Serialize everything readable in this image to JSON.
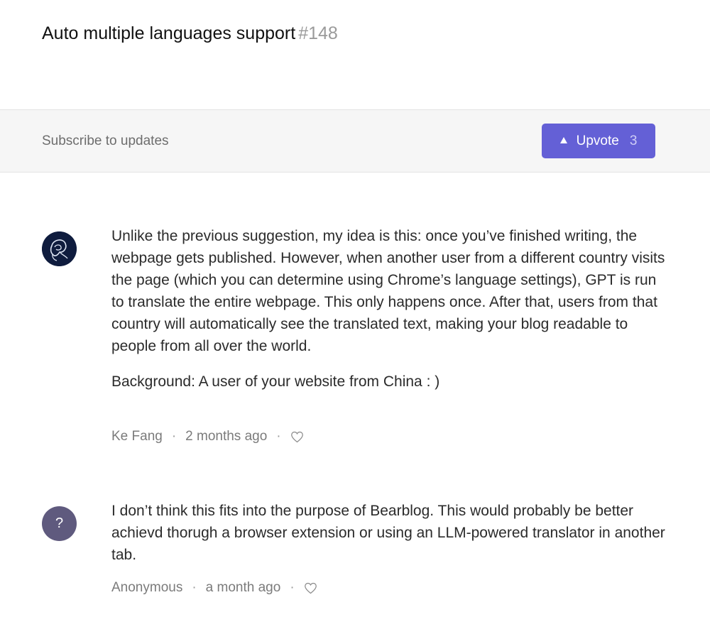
{
  "post": {
    "title": "Auto multiple languages support",
    "number": "#148"
  },
  "toolbar": {
    "subscribe_label": "Subscribe to updates",
    "upvote_label": "Upvote",
    "upvote_count": "3",
    "accent_color": "#6460d6"
  },
  "comments": [
    {
      "avatar": "custom-photo",
      "paragraphs": [
        "Unlike the previous suggestion, my idea is this: once you’ve finished writing, the webpage gets published. However, when another user from a different country visits the page (which you can determine using Chrome’s language settings), GPT is run to translate the entire webpage. This only happens once. After that, users from that country will automatically see the translated text, making your blog readable to people from all over the world.",
        "Background: A user of your website from China : )"
      ],
      "author": "Ke Fang",
      "time": "2 months ago",
      "separator": "·",
      "like_icon": "heart-icon"
    },
    {
      "avatar": "?",
      "paragraphs": [
        "I don’t think this fits into the purpose of Bearblog. This would probably be better achievd thorugh a browser extension or using an LLM-powered translator in another tab."
      ],
      "author": "Anonymous",
      "time": "a month ago",
      "separator": "·",
      "like_icon": "heart-icon"
    }
  ]
}
